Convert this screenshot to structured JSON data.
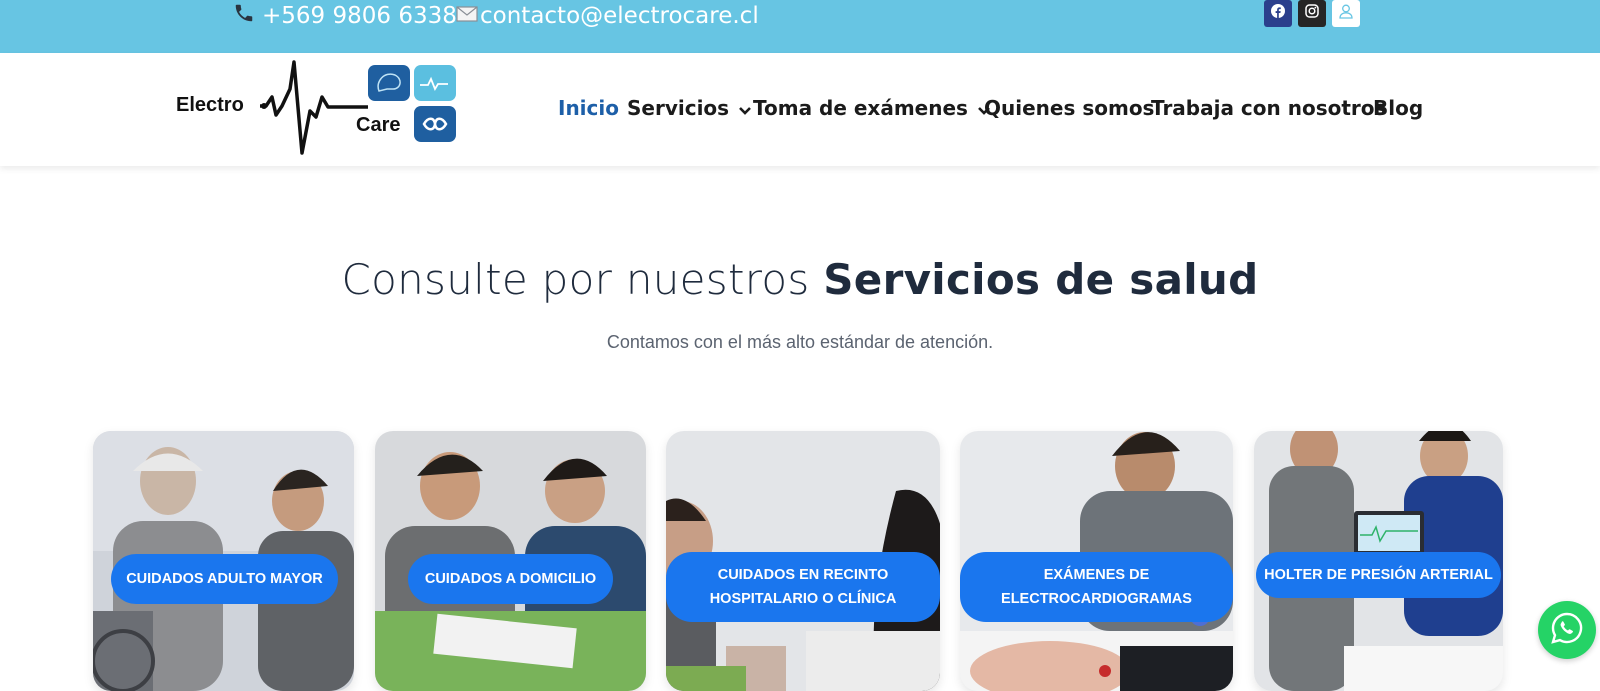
{
  "topbar": {
    "phone": "+569 9806 6338",
    "email": "contacto@electrocare.cl",
    "phone_icon": "phone-icon",
    "email_icon": "envelope-icon",
    "social": [
      "facebook-icon",
      "instagram-icon",
      "user-icon"
    ],
    "bg_color": "#67c5e3"
  },
  "logo": {
    "word1": "Electro",
    "word2": "Care"
  },
  "nav": {
    "items": [
      {
        "label": "Inicio",
        "active": true
      },
      {
        "label": "Servicios",
        "dropdown": true
      },
      {
        "label": "Toma de exámenes",
        "dropdown": true
      },
      {
        "label": "Quienes somos"
      },
      {
        "label": "Trabaja con nosotros"
      },
      {
        "label": "Blog"
      }
    ],
    "active_color": "#1d5fa8"
  },
  "section": {
    "title_light": "Consulte por nuestros ",
    "title_bold": "Servicios de salud",
    "subtitle": "Contamos con el más alto estándar de atención."
  },
  "cards": [
    {
      "label": "CUIDADOS ADULTO MAYOR"
    },
    {
      "label": "CUIDADOS A DOMICILIO"
    },
    {
      "label": "CUIDADOS EN RECINTO HOSPITALARIO O CLÍNICA"
    },
    {
      "label": "EXÁMENES DE ELECTROCARDIOGRAMAS"
    },
    {
      "label": "HOLTER DE PRESIÓN ARTERIAL"
    }
  ],
  "pill_color": "#1a76ee",
  "whatsapp": {
    "icon": "whatsapp-icon",
    "color": "#25d366"
  }
}
